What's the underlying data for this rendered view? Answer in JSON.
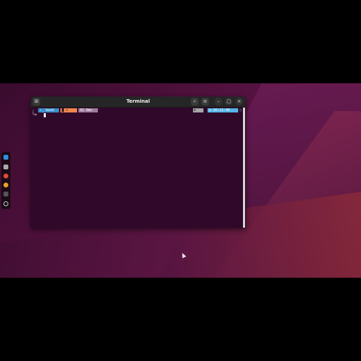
{
  "window": {
    "title": "Terminal",
    "new_tab_icon": "new-tab-icon",
    "search_icon": "search-icon",
    "menu_icon": "hamburger-menu-icon",
    "minimize_glyph": "–",
    "maximize_glyph": "▢",
    "close_glyph": "×"
  },
  "prompt": {
    "shell_label": "bash",
    "duration_label": "92 0ms",
    "time_label": "16:21:46",
    "second_line_symbol": "╰>",
    "colors": {
      "shell_bg": "#3a8ec9",
      "folder_bg": "#f0874f",
      "duration_bg": "#9c7a9c",
      "gear_bg": "#a6a6a6",
      "time_bg": "#54b4e6",
      "terminal_bg": "#30092a"
    }
  },
  "dock": {
    "items": [
      {
        "name": "vscode-icon",
        "color": "#2f8fdd"
      },
      {
        "name": "files-icon",
        "color": "#a9a9a9"
      },
      {
        "name": "app-red-icon",
        "color": "#e04a3a"
      },
      {
        "name": "chrome-icon",
        "color": "#e8a12a"
      },
      {
        "name": "terminal-app-icon",
        "color": "#555555"
      },
      {
        "name": "settings-icon",
        "color": "#cfcfcf"
      }
    ]
  }
}
